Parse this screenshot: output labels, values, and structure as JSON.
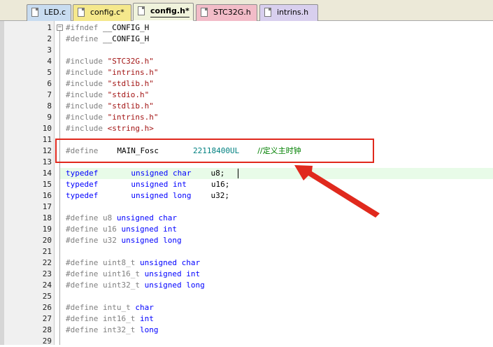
{
  "tabs": [
    {
      "label": "LED.c",
      "color": "#c8dcf0",
      "active": false
    },
    {
      "label": "config.c*",
      "color": "#f5e88c",
      "active": false
    },
    {
      "label": "config.h*",
      "color": "#f0f3dc",
      "active": true
    },
    {
      "label": "STC32G.h",
      "color": "#f2bcc8",
      "active": false
    },
    {
      "label": "intrins.h",
      "color": "#d8cfee",
      "active": false
    }
  ],
  "line_numbers": [
    "1",
    "2",
    "3",
    "4",
    "5",
    "6",
    "7",
    "8",
    "9",
    "10",
    "11",
    "12",
    "13",
    "14",
    "15",
    "16",
    "17",
    "18",
    "19",
    "20",
    "21",
    "22",
    "23",
    "24",
    "25",
    "26",
    "27",
    "28",
    "29"
  ],
  "code": {
    "l1": {
      "a": "#ifndef",
      "b": "__CONFIG_H"
    },
    "l2": {
      "a": "#define",
      "b": "__CONFIG_H"
    },
    "l4": {
      "a": "#include",
      "b": "\"STC32G.h\""
    },
    "l5": {
      "a": "#include",
      "b": "\"intrins.h\""
    },
    "l6": {
      "a": "#include",
      "b": "\"stdlib.h\""
    },
    "l7": {
      "a": "#include",
      "b": "\"stdio.h\""
    },
    "l8": {
      "a": "#include",
      "b": "\"stdlib.h\""
    },
    "l9": {
      "a": "#include",
      "b": "\"intrins.h\""
    },
    "l10": {
      "a": "#include",
      "b": "<string.h>"
    },
    "l12": {
      "a": "#define",
      "b": "MAIN_Fosc",
      "c": "22118400UL",
      "d": "//定义主时钟"
    },
    "l14": {
      "a": "typedef",
      "b": "unsigned char",
      "c": "u8;"
    },
    "l15": {
      "a": "typedef",
      "b": "unsigned int",
      "c": "u16;"
    },
    "l16": {
      "a": "typedef",
      "b": "unsigned long",
      "c": "u32;"
    },
    "l18": {
      "a": "#define u8",
      "b": "unsigned char"
    },
    "l19": {
      "a": "#define u16",
      "b": "unsigned int"
    },
    "l20": {
      "a": "#define u32",
      "b": "unsigned long"
    },
    "l22": {
      "a": "#define uint8_t",
      "b": "unsigned char"
    },
    "l23": {
      "a": "#define uint16_t",
      "b": "unsigned int"
    },
    "l24": {
      "a": "#define uint32_t",
      "b": "unsigned long"
    },
    "l26": {
      "a": "#define intu_t",
      "b": "char"
    },
    "l27": {
      "a": "#define int16_t",
      "b": "int"
    },
    "l28": {
      "a": "#define int32_t",
      "b": "long"
    }
  },
  "colors": {
    "annotation": "#e0291d",
    "current_line": "#e8fbe8"
  }
}
